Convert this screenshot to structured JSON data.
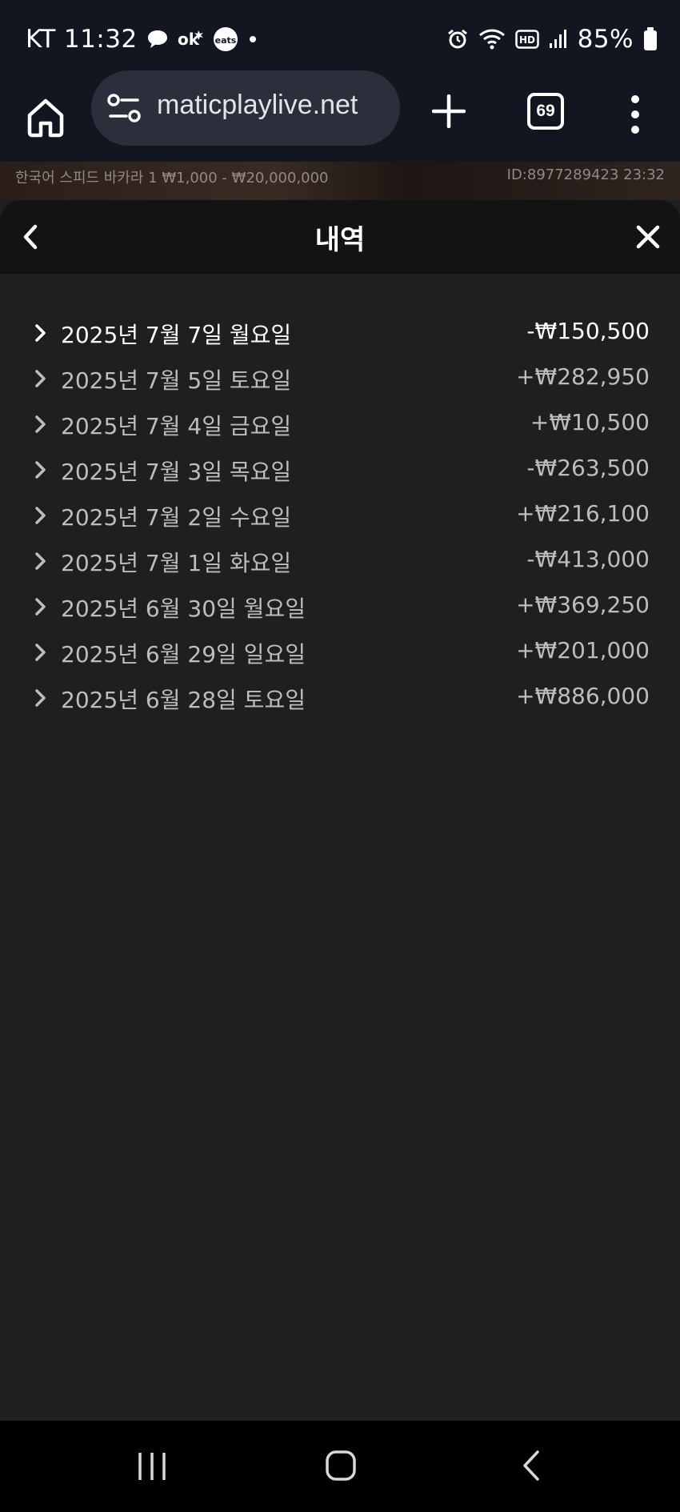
{
  "status_bar": {
    "carrier": "KT",
    "time": "11:32",
    "battery": "85%",
    "icons": [
      "talk-icon",
      "ok-icon",
      "coupang-eats-icon",
      "dot-icon",
      "alarm-icon",
      "wifi-icon",
      "hd-icon",
      "signal-icon",
      "battery-icon"
    ],
    "coupang_label": "eats"
  },
  "browser": {
    "url": "maticplaylive.net",
    "tab_count": "69"
  },
  "game_info": {
    "table_name": "한국어 스피드 바카라 1 ₩1,000 - ₩20,000,000",
    "id_time": "ID:8977289423  23:32"
  },
  "panel": {
    "title": "내역",
    "history": [
      {
        "date": "2025년 7월 7일 월요일",
        "amount": "-₩150,500",
        "active": true
      },
      {
        "date": "2025년 7월 5일 토요일",
        "amount": "+₩282,950",
        "active": false
      },
      {
        "date": "2025년 7월 4일 금요일",
        "amount": "+₩10,500",
        "active": false
      },
      {
        "date": "2025년 7월 3일 목요일",
        "amount": "-₩263,500",
        "active": false
      },
      {
        "date": "2025년 7월 2일 수요일",
        "amount": "+₩216,100",
        "active": false
      },
      {
        "date": "2025년 7월 1일 화요일",
        "amount": "-₩413,000",
        "active": false
      },
      {
        "date": "2025년 6월 30일 월요일",
        "amount": "+₩369,250",
        "active": false
      },
      {
        "date": "2025년 6월 29일 일요일",
        "amount": "+₩201,000",
        "active": false
      },
      {
        "date": "2025년 6월 28일 토요일",
        "amount": "+₩886,000",
        "active": false
      }
    ]
  },
  "colors": {
    "status_bg": "#121621",
    "panel_bg": "#1f1e21",
    "header_bg": "#131314",
    "text_active": "#ffffff",
    "text_muted": "#bdbdbf"
  }
}
